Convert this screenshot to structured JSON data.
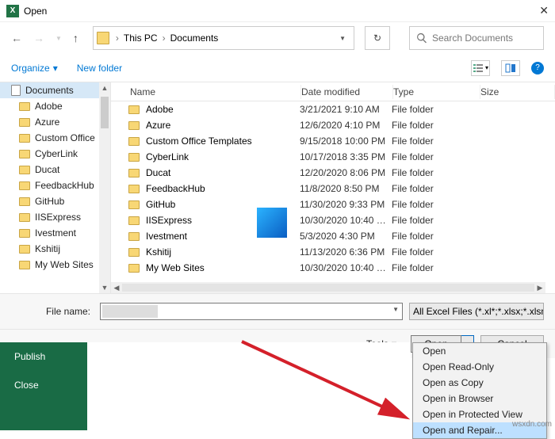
{
  "window": {
    "title": "Open",
    "close": "✕"
  },
  "nav": {
    "back": "←",
    "forward": "→",
    "up": "↑",
    "crumbs": [
      "This PC",
      "Documents"
    ],
    "refresh": "↻",
    "search_placeholder": "Search Documents"
  },
  "toolbar": {
    "organize": "Organize",
    "newfolder": "New folder"
  },
  "tree": {
    "root": "Documents",
    "items": [
      "Adobe",
      "Azure",
      "Custom Office",
      "CyberLink",
      "Ducat",
      "FeedbackHub",
      "GitHub",
      "IISExpress",
      "Ivestment",
      "Kshitij",
      "My Web Sites"
    ]
  },
  "columns": {
    "name": "Name",
    "date": "Date modified",
    "type": "Type",
    "size": "Size"
  },
  "files": [
    {
      "name": "Adobe",
      "date": "3/21/2021 9:10 AM",
      "type": "File folder"
    },
    {
      "name": "Azure",
      "date": "12/6/2020 4:10 PM",
      "type": "File folder"
    },
    {
      "name": "Custom Office Templates",
      "date": "9/15/2018 10:00 PM",
      "type": "File folder"
    },
    {
      "name": "CyberLink",
      "date": "10/17/2018 3:35 PM",
      "type": "File folder"
    },
    {
      "name": "Ducat",
      "date": "12/20/2020 8:06 PM",
      "type": "File folder"
    },
    {
      "name": "FeedbackHub",
      "date": "11/8/2020 8:50 PM",
      "type": "File folder"
    },
    {
      "name": "GitHub",
      "date": "11/30/2020 9:33 PM",
      "type": "File folder"
    },
    {
      "name": "IISExpress",
      "date": "10/30/2020 10:40 …",
      "type": "File folder"
    },
    {
      "name": "Ivestment",
      "date": "5/3/2020 4:30 PM",
      "type": "File folder"
    },
    {
      "name": "Kshitij",
      "date": "11/13/2020 6:36 PM",
      "type": "File folder"
    },
    {
      "name": "My Web Sites",
      "date": "10/30/2020 10:40 …",
      "type": "File folder"
    }
  ],
  "filename": {
    "label": "File name:",
    "filter": "All Excel Files (*.xl*;*.xlsx;*.xlsm;"
  },
  "buttons": {
    "tools": "Tools",
    "open": "Open",
    "cancel": "Cancel"
  },
  "dropdown": {
    "items": [
      "Open",
      "Open Read-Only",
      "Open as Copy",
      "Open in Browser",
      "Open in Protected View",
      "Open and Repair..."
    ],
    "highlight": 5
  },
  "backstage": {
    "publish": "Publish",
    "close": "Close"
  },
  "watermark": "wsxdn.com",
  "icons": {
    "excel": "X",
    "help": "?",
    "caret": "▾",
    "caret_sm": "▼",
    "chev": "›",
    "sarrow_l": "◀",
    "sarrow_r": "▶",
    "sarrow_u": "▲",
    "sarrow_d": "▼"
  }
}
